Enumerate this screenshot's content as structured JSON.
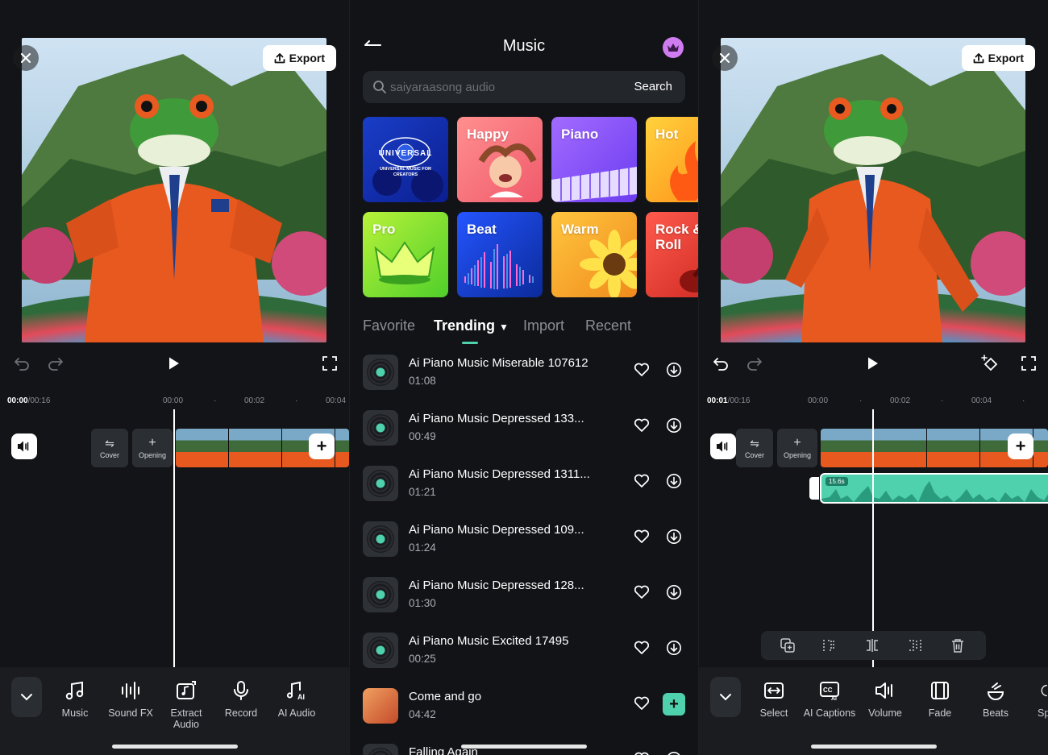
{
  "left_editor": {
    "export_label": "Export",
    "time_current": "00:00",
    "time_total": "/00:16",
    "ruler": [
      "00:00",
      "00:02",
      "00:04"
    ],
    "cover_label": "Cover",
    "opening_label": "Opening",
    "tools": [
      {
        "label": "Music",
        "icon": "music-note-icon"
      },
      {
        "label": "Sound FX",
        "icon": "sound-fx-icon"
      },
      {
        "label": "Extract Audio",
        "icon": "extract-audio-icon"
      },
      {
        "label": "Record",
        "icon": "microphone-icon"
      },
      {
        "label": "AI Audio",
        "icon": "ai-audio-icon"
      }
    ]
  },
  "music": {
    "title": "Music",
    "search_placeholder": "saiyaraasong audio",
    "search_button": "Search",
    "genres": [
      {
        "label": "",
        "brand": "UNIVERSAL",
        "sub": "UNIVERSAL MUSIC FOR CREATORS",
        "colors": [
          "#1a3ec8",
          "#0b1e8f"
        ]
      },
      {
        "label": "Happy",
        "colors": [
          "#ff8f8f",
          "#f05a6b"
        ]
      },
      {
        "label": "Piano",
        "colors": [
          "#a26bff",
          "#6c3cf0"
        ]
      },
      {
        "label": "Hot",
        "colors": [
          "#ffd23d",
          "#ff8a14"
        ]
      },
      {
        "label": "Pro",
        "colors": [
          "#b8f23a",
          "#4fcf2a"
        ]
      },
      {
        "label": "Beat",
        "colors": [
          "#2455ff",
          "#0b2a9a"
        ]
      },
      {
        "label": "Warm",
        "colors": [
          "#ffc63f",
          "#f08a1c"
        ]
      },
      {
        "label": "Rock & Roll",
        "colors": [
          "#ff5a4d",
          "#c9261f"
        ]
      }
    ],
    "tabs": [
      "Favorite",
      "Trending",
      "Import",
      "Recent"
    ],
    "active_tab": "Trending",
    "tracks": [
      {
        "name": "Ai Piano Music Miserable 107612",
        "duration": "01:08"
      },
      {
        "name": "Ai Piano Music Depressed 133...",
        "duration": "00:49"
      },
      {
        "name": "Ai Piano Music Depressed 1311...",
        "duration": "01:21"
      },
      {
        "name": "Ai Piano Music Depressed 109...",
        "duration": "01:24"
      },
      {
        "name": "Ai Piano Music Depressed 128...",
        "duration": "01:30"
      },
      {
        "name": "Ai Piano Music Excited 17495",
        "duration": "00:25"
      },
      {
        "name": "Come and go",
        "duration": "04:42"
      },
      {
        "name": "Falling Again",
        "duration": ""
      }
    ]
  },
  "right_editor": {
    "export_label": "Export",
    "time_current": "00:01",
    "time_total": "/00:16",
    "ruler": [
      "00:00",
      "00:02",
      "00:04"
    ],
    "cover_label": "Cover",
    "opening_label": "Opening",
    "audio_length": "15.6s",
    "tools": [
      {
        "label": "Select",
        "icon": "select-icon"
      },
      {
        "label": "AI Captions",
        "icon": "ai-captions-icon"
      },
      {
        "label": "Volume",
        "icon": "volume-icon"
      },
      {
        "label": "Fade",
        "icon": "fade-icon"
      },
      {
        "label": "Beats",
        "icon": "beats-icon"
      },
      {
        "label": "Sp",
        "icon": "speed-icon"
      }
    ]
  },
  "colors": {
    "accent": "#4fd1ae",
    "background": "#121417",
    "surface": "#23262b"
  }
}
